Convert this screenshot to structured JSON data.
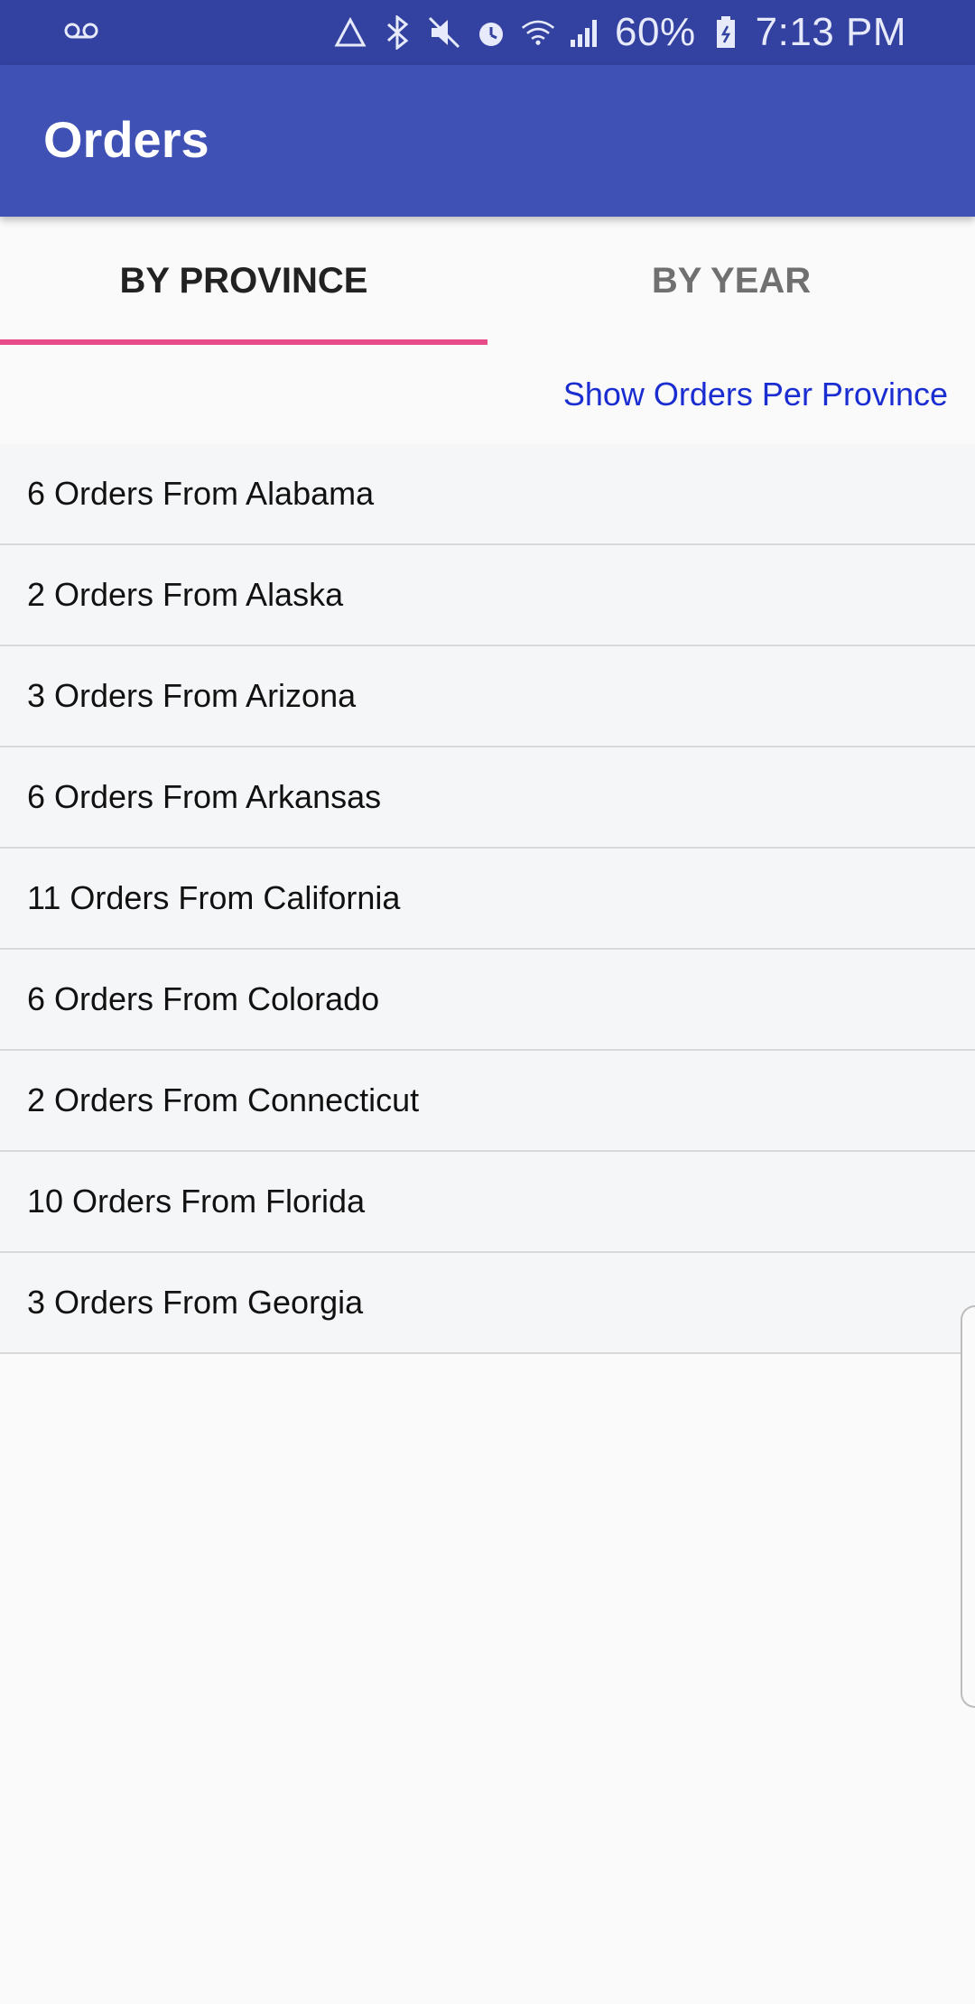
{
  "status_bar": {
    "battery": "60%",
    "time": "7:13 PM",
    "icons": [
      "voicemail-icon",
      "data-saver-icon",
      "bluetooth-icon",
      "mute-icon",
      "alarm-icon",
      "wifi-icon",
      "signal-icon",
      "battery-icon"
    ]
  },
  "app_bar": {
    "title": "Orders",
    "color": "#3f51b5"
  },
  "tabs": [
    {
      "label": "BY PROVINCE",
      "active": true
    },
    {
      "label": "BY YEAR",
      "active": false
    }
  ],
  "accent_color": "#e84c88",
  "show_orders_link": "Show Orders Per Province",
  "orders": [
    "6 Orders From Alabama",
    "2 Orders From Alaska",
    "3 Orders From Arizona",
    "6 Orders From Arkansas",
    "11 Orders From California",
    "6 Orders From Colorado",
    "2 Orders From Connecticut",
    "10 Orders From Florida",
    "3 Orders From Georgia"
  ]
}
